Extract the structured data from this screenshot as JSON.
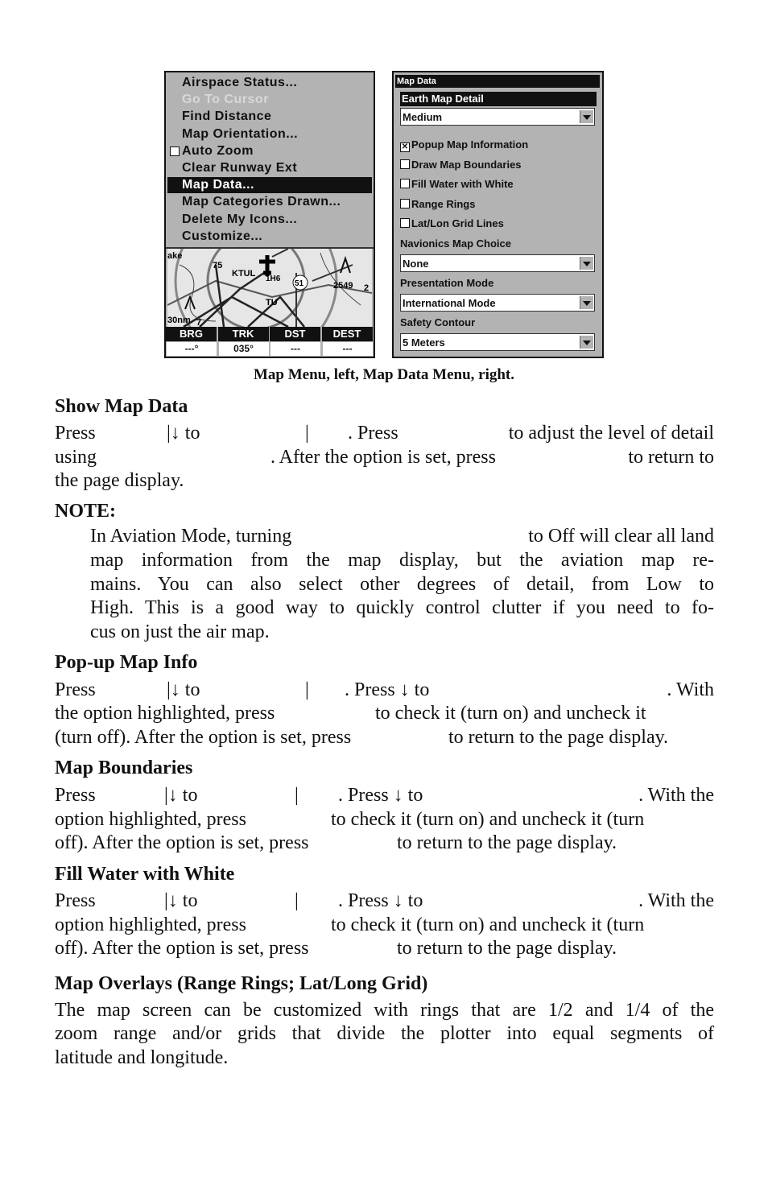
{
  "left_screen": {
    "menu_items": [
      {
        "label": "Airspace Status...",
        "state": "normal"
      },
      {
        "label": "Go To Cursor",
        "state": "disabled"
      },
      {
        "label": "Find Distance",
        "state": "normal"
      },
      {
        "label": "Map Orientation...",
        "state": "normal"
      },
      {
        "label": "Auto Zoom",
        "state": "checkbox-unchecked"
      },
      {
        "label": "Clear Runway Ext",
        "state": "normal"
      },
      {
        "label": "Map Data...",
        "state": "selected"
      },
      {
        "label": "Map Categories Drawn...",
        "state": "normal"
      },
      {
        "label": "Delete My Icons...",
        "state": "normal"
      },
      {
        "label": "Customize...",
        "state": "normal"
      }
    ],
    "map_labels": [
      "ake",
      "75",
      "KTUL",
      "1H6",
      "51",
      "2549",
      "TU",
      "30nm",
      "7",
      "2"
    ],
    "status_headers": [
      "BRG",
      "TRK",
      "DST",
      "DEST"
    ],
    "status_values": [
      "---°",
      "035°",
      "---",
      "---"
    ]
  },
  "right_screen": {
    "title": "Map Data",
    "earth_map_detail_label": "Earth Map Detail",
    "earth_map_detail_value": "Medium",
    "checkboxes": [
      {
        "label": "Popup Map Information",
        "checked": true
      },
      {
        "label": "Draw Map Boundaries",
        "checked": false
      },
      {
        "label": "Fill Water with White",
        "checked": false
      },
      {
        "label": "Range Rings",
        "checked": false
      },
      {
        "label": "Lat/Lon Grid Lines",
        "checked": false
      }
    ],
    "navionics_label": "Navionics Map Choice",
    "navionics_value": "None",
    "presentation_label": "Presentation Mode",
    "presentation_value": "International Mode",
    "safety_label": "Safety Contour",
    "safety_value": "5 Meters"
  },
  "caption": "Map Menu, left, Map Data Menu, right.",
  "sections": {
    "show_map_data": {
      "heading": "Show Map Data",
      "lines": [
        [
          "Press",
          "|↓ to",
          "|",
          ". Press",
          "to adjust the level of detail"
        ],
        [
          "using",
          ". After the option is set, press",
          "to return to"
        ],
        [
          "the page display."
        ]
      ]
    },
    "note": {
      "heading": "NOTE:",
      "first_line": [
        "In Aviation Mode, turning",
        "to Off will clear all land"
      ],
      "lines": [
        "map information from the map display, but the aviation map re-",
        "mains. You can also select other degrees of detail, from Low to",
        "High. This is a good way to quickly control clutter if you need to fo-",
        "cus on just the air map."
      ]
    },
    "popup": {
      "heading": "Pop-up Map Info",
      "lines": [
        [
          "Press",
          "|↓ to",
          "|",
          ". Press ↓ to",
          ". With"
        ],
        [
          "the option highlighted, press",
          "to check it (turn on) and uncheck it"
        ],
        [
          "(turn off). After the option is set, press",
          "to return to the page display."
        ]
      ]
    },
    "boundaries": {
      "heading": "Map Boundaries",
      "lines": [
        [
          "Press",
          "|↓ to",
          "|",
          ". Press ↓ to",
          ". With the"
        ],
        [
          "option highlighted, press",
          "to check it (turn on) and uncheck it (turn"
        ],
        [
          "off). After the option is set, press",
          "to return to the page display."
        ]
      ]
    },
    "fill_water": {
      "heading": "Fill Water with White",
      "lines": [
        [
          "Press",
          "|↓ to",
          "|",
          ". Press ↓ to",
          ". With the"
        ],
        [
          "option highlighted, press",
          "to check it (turn on) and uncheck it (turn"
        ],
        [
          "off). After the option is set, press",
          "to return to the page display."
        ]
      ]
    },
    "overlays": {
      "heading": "Map Overlays (Range Rings; Lat/Long Grid)",
      "lines": [
        "The map screen can be customized with rings that are 1/2 and 1/4 of the",
        "zoom range and/or grids that divide the plotter into equal segments of",
        "latitude and longitude."
      ]
    }
  }
}
